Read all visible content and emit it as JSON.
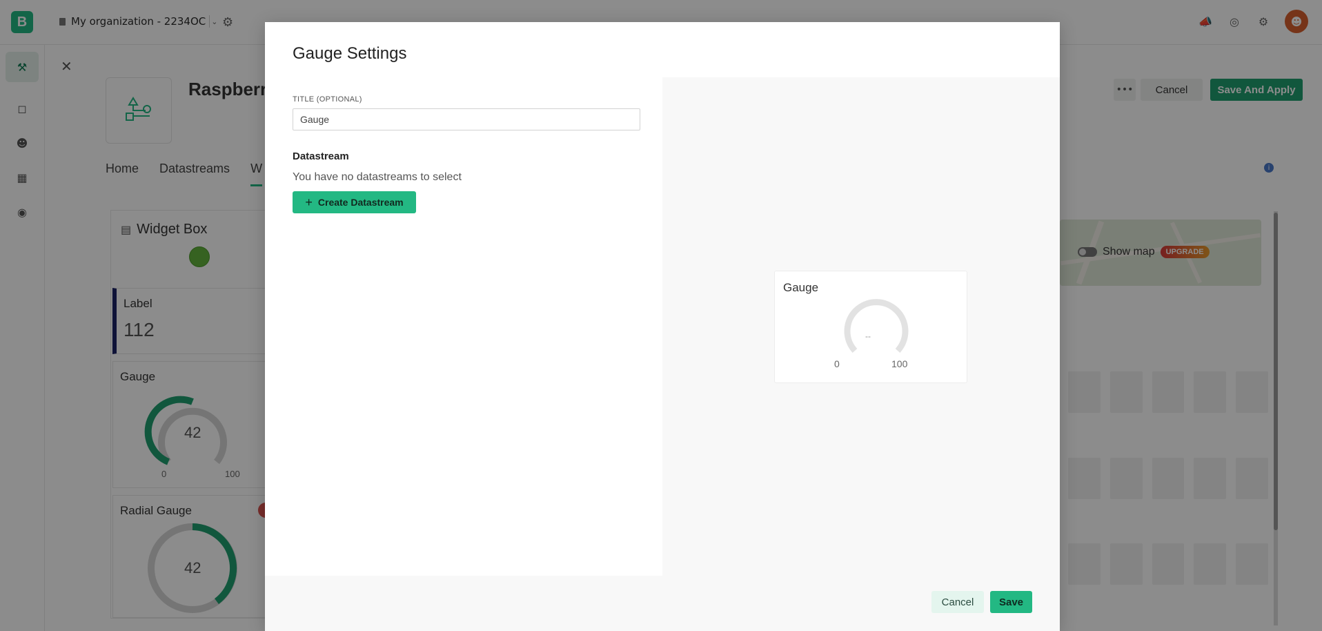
{
  "app": {
    "logo_letter": "B",
    "organization": "My organization - 2234OC",
    "brand_color": "#23b883"
  },
  "background": {
    "template_name": "Raspberry",
    "tabs": [
      "Home",
      "Datastreams",
      "W"
    ],
    "header_buttons": {
      "more": "•••",
      "cancel": "Cancel",
      "save_apply": "Save And Apply"
    },
    "widget_box": {
      "title": "Widget Box",
      "label_widget": {
        "title": "Label",
        "value": "112"
      },
      "gauge_widget": {
        "title": "Gauge",
        "value": "42",
        "min": "0",
        "max": "100"
      },
      "radial_widget": {
        "title": "Radial Gauge",
        "value": "42"
      }
    },
    "map": {
      "show_map_label": "Show map",
      "upgrade_badge": "UPGRADE"
    }
  },
  "modal": {
    "title": "Gauge Settings",
    "title_field": {
      "label": "TITLE (OPTIONAL)",
      "value": "Gauge"
    },
    "datastream": {
      "heading": "Datastream",
      "empty_message": "You have no datastreams to select",
      "create_button": "Create Datastream"
    },
    "preview": {
      "title": "Gauge",
      "value": "--",
      "min": "0",
      "max": "100"
    },
    "footer": {
      "cancel": "Cancel",
      "save": "Save"
    }
  }
}
